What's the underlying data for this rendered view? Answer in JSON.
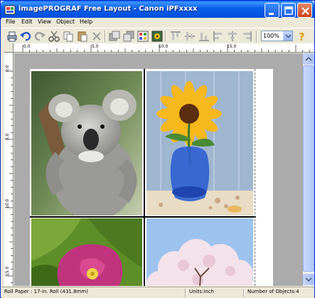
{
  "window": {
    "title": "imagePROGRAF Free Layout - Canon iPFxxxx",
    "controls": [
      "minimize",
      "maximize",
      "close"
    ]
  },
  "menu": {
    "items": [
      "File",
      "Edit",
      "View",
      "Object",
      "Help"
    ]
  },
  "toolbar": {
    "buttons": [
      "print-icon",
      "undo-icon",
      "redo-icon",
      "cut-icon",
      "copy-icon",
      "paste-icon",
      "delete-icon",
      "bring-front-icon",
      "send-back-icon",
      "preview-icon",
      "image-icon",
      "align-top-icon",
      "align-middle-icon",
      "align-bottom-icon",
      "align-left-icon",
      "align-right-icon",
      "help-icon"
    ],
    "zoom": "100%"
  },
  "rulers": {
    "horizontal_labels": [
      "0.0",
      "5.0",
      "10.0",
      "15.0"
    ],
    "vertical_labels": [
      "0.0",
      "5.0",
      "10.0",
      "15.0"
    ]
  },
  "canvas": {
    "photos": [
      "koala",
      "sunflower",
      "flower-leaves",
      "cherry-blossom"
    ]
  },
  "status": {
    "roll_paper": "Roll Paper : 17-in. Roll (431.8mm)",
    "units": "Units:inch",
    "objects": "Number of Objects:4"
  },
  "colors": {
    "title_bar": "#0A5FE8",
    "canvas_bg": "#ABABAB",
    "window_bg": "#ECE9D8"
  }
}
